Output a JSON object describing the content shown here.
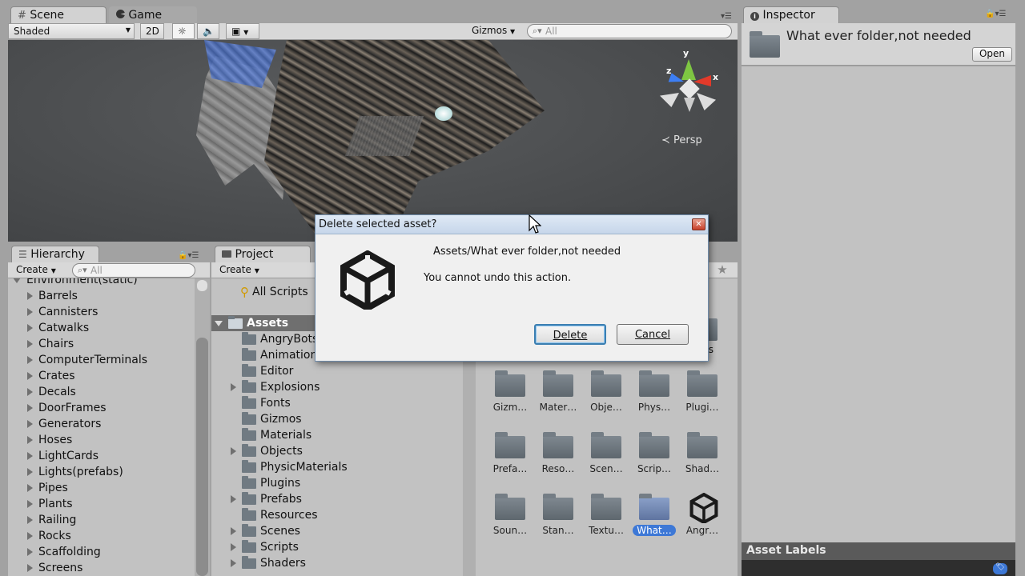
{
  "scene": {
    "tabs": [
      {
        "label": "Scene"
      },
      {
        "label": "Game"
      }
    ],
    "shading": "Shaded",
    "mode_2d": "2D",
    "gizmos": "Gizmos",
    "search_placeholder": "All",
    "persp_label": "Persp",
    "axes": {
      "x": "x",
      "y": "y",
      "z": "z"
    }
  },
  "inspector": {
    "tab": "Inspector",
    "title": "What ever folder,not needed",
    "open_label": "Open",
    "asset_labels": "Asset Labels"
  },
  "hierarchy": {
    "tab": "Hierarchy",
    "create": "Create",
    "search_placeholder": "All",
    "root": "Environment(static)",
    "items": [
      "Barrels",
      "Cannisters",
      "Catwalks",
      "Chairs",
      "ComputerTerminals",
      "Crates",
      "Decals",
      "DoorFrames",
      "Generators",
      "Hoses",
      "LightCards",
      "Lights(prefabs)",
      "Pipes",
      "Plants",
      "Railing",
      "Rocks",
      "Scaffolding",
      "Screens"
    ]
  },
  "project": {
    "tab": "Project",
    "create": "Create",
    "all_scripts": "All Scripts",
    "assets_root": "Assets",
    "tree": [
      {
        "label": "AngryBots",
        "expandable": false
      },
      {
        "label": "Animation",
        "expandable": false
      },
      {
        "label": "Editor",
        "expandable": false
      },
      {
        "label": "Explosions",
        "expandable": true
      },
      {
        "label": "Fonts",
        "expandable": false
      },
      {
        "label": "Gizmos",
        "expandable": false
      },
      {
        "label": "Materials",
        "expandable": false
      },
      {
        "label": "Objects",
        "expandable": true
      },
      {
        "label": "PhysicMaterials",
        "expandable": false
      },
      {
        "label": "Plugins",
        "expandable": false
      },
      {
        "label": "Prefabs",
        "expandable": true
      },
      {
        "label": "Resources",
        "expandable": false
      },
      {
        "label": "Scenes",
        "expandable": true
      },
      {
        "label": "Scripts",
        "expandable": true
      },
      {
        "label": "Shaders",
        "expandable": true
      }
    ],
    "grid_partial_label": "ts",
    "grid": [
      [
        "Gizm…",
        "Mater…",
        "Obje…",
        "Phys…",
        "Plugi…"
      ],
      [
        "Prefa…",
        "Reso…",
        "Scen…",
        "Scrip…",
        "Shad…"
      ],
      [
        "Soun…",
        "Stan…",
        "Textu…",
        "What…",
        "Angr…"
      ]
    ]
  },
  "dialog": {
    "title": "Delete selected asset?",
    "path": "Assets/What ever folder,not needed",
    "message": "You cannot undo this action.",
    "delete_label": "Delete",
    "cancel_label": "Cancel"
  },
  "colors": {
    "selection": "#3d78d6",
    "viewport": "#4a4c4e"
  }
}
